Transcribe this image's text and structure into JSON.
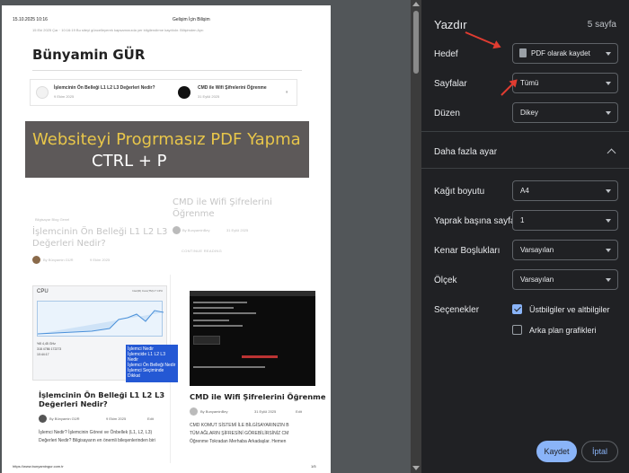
{
  "preview": {
    "header_date": "15.10.2025 10:16",
    "header_title": "Gelişim İçin Bilişim",
    "topbar": "15 Eki 2025 Çar · 10:16:19   Bu siteyi güncelleyerek kapsamınızda yer bilgilendirme kayıtlıdır.   Bilişimden Ayrı",
    "site_name": "Bünyamin GÜR",
    "related": [
      {
        "title": "İşlemcinin Ön Belleği L1 L2 L3 Değerleri Nedir?",
        "date": "9 Ekim 2025"
      },
      {
        "title": "CMD ile Wifi Şifrelerini Öğrenme",
        "date": "31 Eylül 2025"
      }
    ],
    "pause_glyph": "⏸",
    "banner_line1": "Websiteyi Progrmasız PDF Yapma",
    "banner_line2": "CTRL + P",
    "post_right": {
      "title": "CMD ile Wifi Şifrelerini Öğrenme",
      "author": "By BunyaminBey",
      "date": "31 Eylül 2025",
      "cta": "CONTINUE READING"
    },
    "post_left": {
      "categories": "Bilgisayar    Blog    Genel",
      "title": "İşlemcinin Ön Belleği L1 L2 L3 Değerleri Nedir?",
      "author": "By Bünyamin GÜR",
      "date": "9 Ekim 2025"
    },
    "card_left": {
      "cpu_label": "CPU",
      "cpu_model": "Intel(R) Core(TM) i7 CPU",
      "cpu_stats": [
        "%5   4,45 GHz",
        "318   4786   172273",
        "10:44:17"
      ],
      "tooltip": [
        "İşlemci Nedir",
        "İşlemcide L1 L2 L3 Nedir",
        "İşlemci Ön Belleği Nedir",
        "İşlemci Seçiminde Dikkat"
      ],
      "title": "İşlemcinin Ön Belleği L1 L2 L3 Değerleri Nedir?",
      "author": "By Bünyamin GÜR",
      "date": "9 Ekim 2025",
      "edit": "Edit",
      "excerpt": [
        "İşlemci Nedir? İşlemcinin Görevi ve Önbellek (L1, L2, L3)",
        "Değerleri Nedir? Bilgisayarın en önemli bileşenlerinden biri"
      ]
    },
    "card_right": {
      "title": "CMD ile Wifi Şifrelerini Öğrenme",
      "author": "By BunyaminBey",
      "date": "31 Eylül 2025",
      "edit": "Edit",
      "excerpt": [
        "CMD KOMUT SİSTEMİ İLE BİLGİSAYARINIZIN B",
        "TÜM AĞLARIN ŞİFRESİNİ GÖREBİLİRSİNİZ CM",
        "Öğrenme Tokradan Merhaba Arkadaşlar. Hemen"
      ]
    },
    "footer_url": "https://www.bunyamingur.com.tr",
    "footer_page": "1/5"
  },
  "print_panel": {
    "title": "Yazdır",
    "sheet_count": "5 sayfa",
    "destination": {
      "label": "Hedef",
      "value": "PDF olarak kaydet"
    },
    "pages": {
      "label": "Sayfalar",
      "value": "Tümü"
    },
    "layout": {
      "label": "Düzen",
      "value": "Dikey"
    },
    "more_settings": "Daha fazla ayar",
    "paper_size": {
      "label": "Kağıt boyutu",
      "value": "A4"
    },
    "pages_per_sheet": {
      "label": "Yaprak başına sayfa",
      "value": "1"
    },
    "margins": {
      "label": "Kenar Boşlukları",
      "value": "Varsayılan"
    },
    "scale": {
      "label": "Ölçek",
      "value": "Varsayılan"
    },
    "options": {
      "label": "Seçenekler",
      "headers_footers": {
        "label": "Üstbilgiler ve altbilgiler",
        "checked": true
      },
      "background_graphics": {
        "label": "Arka plan grafikleri",
        "checked": false
      }
    },
    "save_button": "Kaydet",
    "cancel_button": "İptal"
  },
  "colors": {
    "panel_bg": "#202124",
    "accent": "#8ab4f8",
    "arrow": "#e03c31",
    "banner_yellow": "#e8c64a"
  }
}
